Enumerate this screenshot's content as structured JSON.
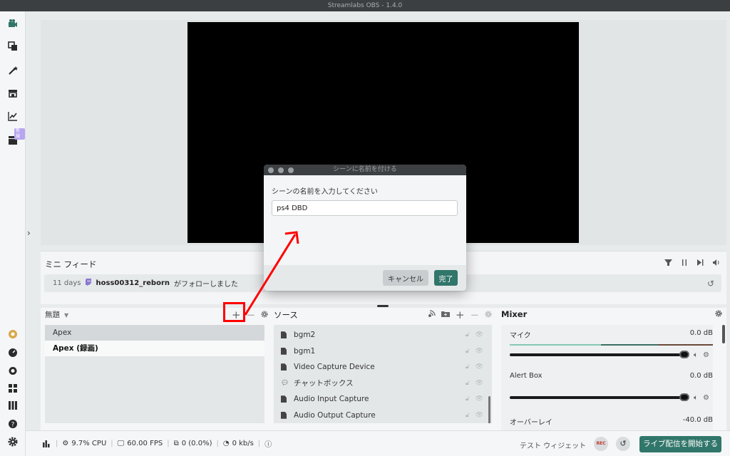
{
  "window": {
    "title": "Streamlabs OBS - 1.4.0"
  },
  "sidebar": {
    "badge": "新規"
  },
  "feed": {
    "title": "ミニ フィード",
    "item": {
      "days": "11 days",
      "user": "hoss00312_reborn",
      "message": "がフォローしました"
    }
  },
  "scenes": {
    "collection": "無題",
    "items": [
      {
        "label": "Apex"
      },
      {
        "label": "Apex (録画)"
      }
    ]
  },
  "sources": {
    "title": "ソース",
    "items": [
      {
        "label": "bgm2",
        "icon": "file-icon"
      },
      {
        "label": "bgm1",
        "icon": "file-icon"
      },
      {
        "label": "Video Capture Device",
        "icon": "file-icon"
      },
      {
        "label": "チャットボックス",
        "icon": "chat-icon"
      },
      {
        "label": "Audio Input Capture",
        "icon": "file-icon"
      },
      {
        "label": "Audio Output Capture",
        "icon": "file-icon"
      }
    ]
  },
  "mixer": {
    "title": "Mixer",
    "channels": [
      {
        "name": "マイク",
        "db": "0.0 dB"
      },
      {
        "name": "Alert Box",
        "db": "0.0 dB"
      },
      {
        "name": "オーバーレイ",
        "db": "-40.0 dB"
      }
    ]
  },
  "footer": {
    "cpu": "9.7% CPU",
    "fps": "60.00 FPS",
    "dropped": "0 (0.0%)",
    "bitrate": "0 kb/s",
    "test_widget": "テスト ウィジェット",
    "rec": "REC",
    "go_live": "ライブ配信を開始する"
  },
  "dialog": {
    "title": "シーンに名前を付ける",
    "prompt": "シーンの名前を入力してください",
    "input_value": "ps4 DBD",
    "cancel": "キャンセル",
    "done": "完了"
  },
  "colors": {
    "accent": "#31766a",
    "annotation": "#ff0000"
  }
}
